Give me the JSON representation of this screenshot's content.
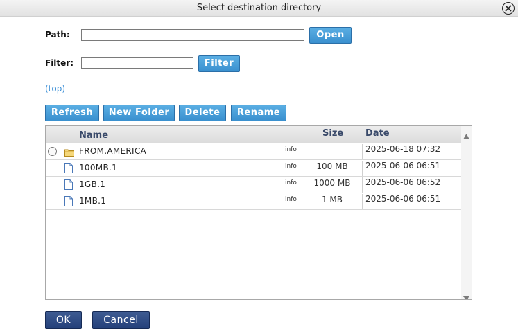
{
  "dialog": {
    "title": "Select destination directory"
  },
  "path": {
    "label": "Path:",
    "value": "",
    "open_label": "Open"
  },
  "filter": {
    "label": "Filter:",
    "value": "",
    "button_label": "Filter"
  },
  "top_link": "(top)",
  "toolbar": {
    "refresh": "Refresh",
    "new_folder": "New Folder",
    "delete": "Delete",
    "rename": "Rename"
  },
  "table": {
    "headers": {
      "name": "Name",
      "size": "Size",
      "date": "Date"
    },
    "rows": [
      {
        "type": "folder",
        "name": "FROM.AMERICA",
        "info": "info",
        "size": "",
        "date": "2025-06-18 07:32"
      },
      {
        "type": "file",
        "name": "100MB.1",
        "info": "info",
        "size": "100 MB",
        "date": "2025-06-06 06:51"
      },
      {
        "type": "file",
        "name": "1GB.1",
        "info": "info",
        "size": "1000 MB",
        "date": "2025-06-06 06:52"
      },
      {
        "type": "file",
        "name": "1MB.1",
        "info": "info",
        "size": "1 MB",
        "date": "2025-06-06 06:51"
      }
    ]
  },
  "footer": {
    "ok": "OK",
    "cancel": "Cancel"
  },
  "colors": {
    "accent_blue": "#3a90cf",
    "dark_button": "#24407a",
    "link": "#3a8ed6"
  },
  "icons": {
    "close": "close-circle-icon",
    "folder": "folder-icon",
    "file": "file-icon"
  }
}
